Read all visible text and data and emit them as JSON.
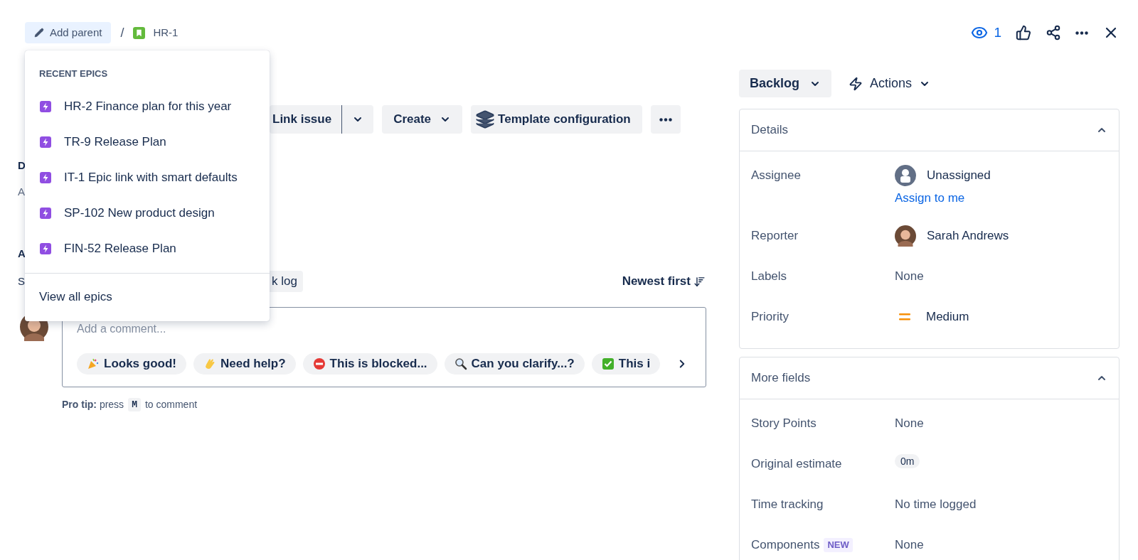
{
  "breadcrumb": {
    "add_parent": "Add parent",
    "separator": "/",
    "issue_key": "HR-1"
  },
  "header_actions": {
    "watchers": "1"
  },
  "epic_menu": {
    "heading": "RECENT EPICS",
    "epics": [
      {
        "label": "HR-2 Finance plan for this year"
      },
      {
        "label": "TR-9 Release Plan"
      },
      {
        "label": "IT-1 Epic link with smart defaults"
      },
      {
        "label": "SP-102 New product design"
      },
      {
        "label": "FIN-52 Release Plan"
      }
    ],
    "footer": "View all epics"
  },
  "issue": {
    "toolbar": [
      {
        "kind": "split",
        "label": "Link issue"
      },
      {
        "kind": "dropdown",
        "label": "Create"
      },
      {
        "kind": "template",
        "label": "Template configuration"
      },
      {
        "kind": "more"
      }
    ],
    "description_heading": "D",
    "description_placeholder": "A",
    "activity_heading": "A",
    "show_label": "S",
    "worklog_tab": "k log",
    "sort": "Newest first"
  },
  "comment": {
    "placeholder": "Add a comment...",
    "quick_replies": [
      {
        "kind": "party",
        "label": "Looks good!"
      },
      {
        "kind": "wave",
        "label": "Need help?"
      },
      {
        "kind": "stop",
        "label": "This is blocked..."
      },
      {
        "kind": "search",
        "label": "Can you clarify...?"
      },
      {
        "kind": "check",
        "label": "This i"
      }
    ],
    "pro_tip": "**Pro tip:** press",
    "key": "M",
    "pro_tip_end": "to comment"
  },
  "sidebar": {
    "status": "Backlog",
    "actions": "Actions",
    "panels": [
      {
        "title": "Details",
        "expanded": true,
        "fields": [
          {
            "kind": "unassigned",
            "label": "Assignee",
            "value": "Unassigned",
            "link": "Assign to me"
          },
          {
            "kind": "user",
            "label": "Reporter",
            "value": "Sarah Andrews"
          },
          {
            "kind": "empty",
            "label": "Labels",
            "value": "None"
          },
          {
            "kind": "priority",
            "label": "Priority",
            "value": "Medium"
          }
        ]
      },
      {
        "title": "More fields",
        "expanded": true,
        "fields": [
          {
            "kind": "empty",
            "label": "Story Points",
            "value": "None"
          },
          {
            "kind": "tag",
            "label": "Original estimate",
            "value": "0m"
          },
          {
            "kind": "empty",
            "label": "Time tracking",
            "value": "No time logged"
          },
          {
            "kind": "empty",
            "label": "Components",
            "badge": "NEW",
            "value": "None"
          }
        ]
      }
    ]
  }
}
